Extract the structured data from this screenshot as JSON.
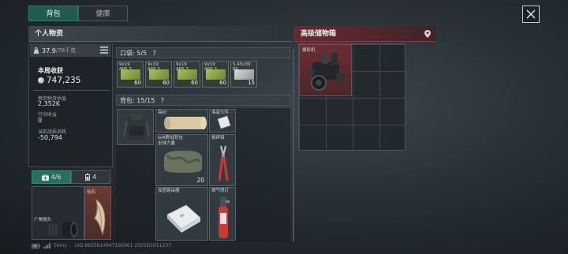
{
  "tabs": [
    {
      "label": "背包",
      "active": true
    },
    {
      "label": "健康",
      "active": false
    }
  ],
  "personal": {
    "title": "个人物资",
    "weight": "37.9",
    "weight_max": "/78千克",
    "income_title": "本局收获",
    "income_value": "747,235",
    "stats": [
      {
        "label": "携带物资估值",
        "value": "2,352K"
      },
      {
        "label": "行动收益",
        "value": "0"
      },
      {
        "label": "当前战损消耗",
        "value": "-50,794"
      }
    ]
  },
  "equip": {
    "tab1_count": "4/6",
    "tab2_count": "4",
    "slot_a_label": "广角镜头",
    "slot_b_label": "化石"
  },
  "pocket": {
    "title": "口袋: 5/5",
    "help": "?",
    "items": [
      {
        "name": "9x19\nAP6.3",
        "count": "60",
        "color": "#8fa64a"
      },
      {
        "name": "9x19\nAP6.3",
        "count": "60",
        "color": "#8fa64a"
      },
      {
        "name": "9x19\nAP6.3",
        "count": "60",
        "color": "#8fa64a"
      },
      {
        "name": "9x19\nAP6.3",
        "count": "60",
        "color": "#8fa64a"
      },
      {
        "name": "5.45x39\nPS",
        "count": "15",
        "color": "#b9bec1"
      }
    ]
  },
  "backpack": {
    "title": "背包: 15/15",
    "help": "?",
    "items": [
      {
        "label": "亮纱"
      },
      {
        "label": "海盗文件"
      },
      {
        "label": "G/R野战背包\n全球力量",
        "count": "20"
      },
      {
        "label": "扳碎钳"
      },
      {
        "label": "加密路由器"
      },
      {
        "label": "燃气喷灯"
      }
    ]
  },
  "advanced": {
    "title": "高级储物箱",
    "item_label": "摄影机"
  },
  "footer": {
    "ping": "59ms",
    "id": "UID:8625814947192961 2025D1011237"
  },
  "colors": {
    "accent_teal": "#1f5b53",
    "accent_red": "#6a2a2e",
    "ammo_green": "#8fa64a"
  }
}
